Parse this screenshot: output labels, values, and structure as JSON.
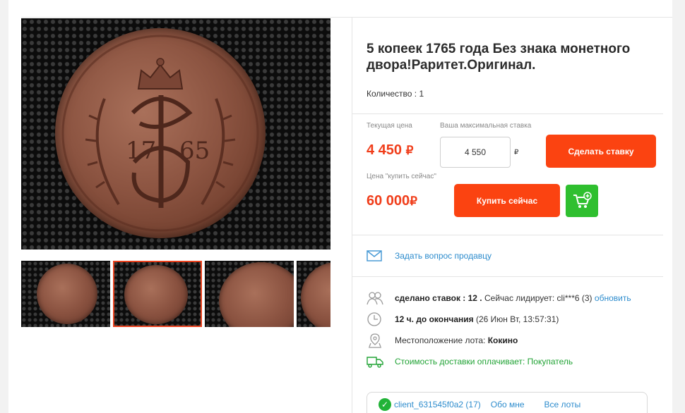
{
  "lot": {
    "title": "5 копеек 1765 года Без знака монетного двора!Раритет.Оригинал.",
    "quantity_label": "Количество : 1"
  },
  "pricing": {
    "current_price_label": "Текущая цена",
    "current_price": "4 450",
    "max_bid_label": "Ваша максимальная ставка",
    "max_bid_value": "4 550",
    "currency_symbol": "₽",
    "bid_button": "Сделать ставку",
    "buy_now_label": "Цена \"купить сейчас\"",
    "buy_now_price": "60 000",
    "buy_now_button": "Купить сейчас"
  },
  "actions": {
    "ask_seller": "Задать вопрос продавцу"
  },
  "details": {
    "bids_label": "сделано ставок : 12 .",
    "leader_text": "Сейчас лидирует: cli***6 (3)",
    "refresh_link": "обновить",
    "time_left": "12 ч. до окончания",
    "end_time": "(26 Июн Вт, 13:57:31)",
    "location_label": "Местоположение лота:",
    "location_value": "Кокино",
    "shipping_text": "Стоимость доставки оплачивает: Покупатель"
  },
  "seller": {
    "name": "client_631545f0a2 (17)",
    "about_link": "Обо мне",
    "all_lots_link": "Все лоты"
  },
  "coin": {
    "date_left": "17",
    "date_right": "65"
  },
  "colors": {
    "accent": "#fb4311",
    "price": "#f03d1a",
    "link": "#2d8ccd",
    "success": "#21a335",
    "cart": "#2fbf2f"
  },
  "icons": [
    "mail-icon",
    "users-icon",
    "clock-icon",
    "location-pin-icon",
    "truck-icon",
    "cart-add-icon",
    "check-icon"
  ]
}
